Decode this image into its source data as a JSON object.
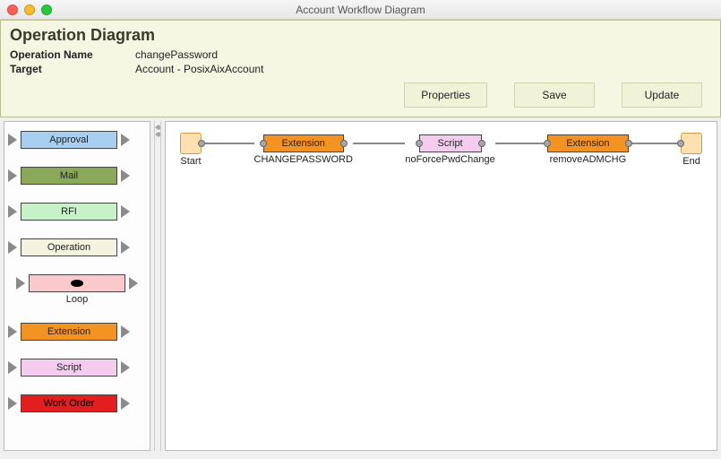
{
  "window": {
    "title": "Account Workflow Diagram"
  },
  "header": {
    "title": "Operation Diagram",
    "opname_label": "Operation Name",
    "opname_value": "changePassword",
    "target_label": "Target",
    "target_value": "Account - PosixAixAccount"
  },
  "buttons": {
    "properties": "Properties",
    "save": "Save",
    "update": "Update"
  },
  "palette": {
    "approval": {
      "label": "Approval",
      "color": "#a9cff0"
    },
    "mail": {
      "label": "Mail",
      "color": "#89a85a"
    },
    "rfi": {
      "label": "RFI",
      "color": "#c6f1c9"
    },
    "operation": {
      "label": "Operation",
      "color": "#f3f3e0"
    },
    "loop": {
      "label": "Loop",
      "color": "#f9c9cc"
    },
    "extension": {
      "label": "Extension",
      "color": "#f39323"
    },
    "script": {
      "label": "Script",
      "color": "#f4cdee"
    },
    "workorder": {
      "label": "Work Order",
      "color": "#e21e1e"
    }
  },
  "flow": {
    "start_label": "Start",
    "end_label": "End",
    "nodes": [
      {
        "type": "extension",
        "title": "Extension",
        "caption": "CHANGEPASSWORD",
        "color": "#f39323"
      },
      {
        "type": "script",
        "title": "Script",
        "caption": "noForcePwdChange",
        "color": "#f4cdee"
      },
      {
        "type": "extension",
        "title": "Extension",
        "caption": "removeADMCHG",
        "color": "#f39323"
      }
    ]
  }
}
